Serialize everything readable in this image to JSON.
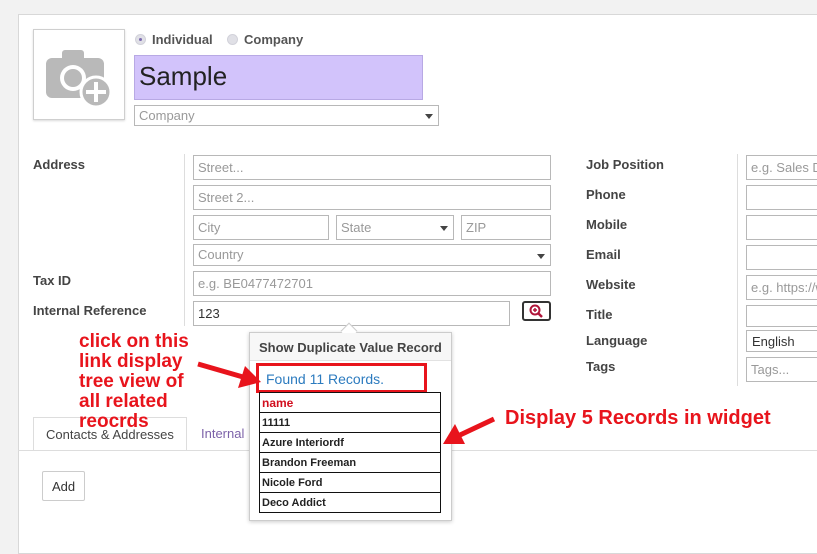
{
  "partner_type": {
    "individual": "Individual",
    "company": "Company",
    "selected": "individual"
  },
  "name": "Sample",
  "company_select": "Company",
  "labels": {
    "address": "Address",
    "tax_id": "Tax ID",
    "internal_reference": "Internal Reference",
    "job_position": "Job Position",
    "phone": "Phone",
    "mobile": "Mobile",
    "email": "Email",
    "website": "Website",
    "title": "Title",
    "language": "Language",
    "tags": "Tags"
  },
  "placeholders": {
    "street": "Street...",
    "street2": "Street 2...",
    "city": "City",
    "state": "State",
    "zip": "ZIP",
    "country": "Country",
    "tax_id": "e.g. BE0477472701",
    "job_position": "e.g. Sales D",
    "website": "e.g. https://w",
    "tags": "Tags..."
  },
  "values": {
    "internal_reference": "123",
    "language": "English"
  },
  "popup": {
    "header": "Show Duplicate Value Record",
    "found_link": "Found 11 Records.",
    "column": "name",
    "records": [
      "11111",
      "Azure Interiordf",
      "Brandon Freeman",
      "Nicole Ford",
      "Deco Addict"
    ]
  },
  "annotations": {
    "left": [
      "click on this",
      "link display",
      "tree view of",
      "all related",
      "reocrds"
    ],
    "right": "Display 5 Records in widget"
  },
  "tabs": [
    {
      "label": "Contacts & Addresses"
    },
    {
      "label": "Internal N"
    }
  ],
  "add_button": "Add",
  "colors": {
    "name_highlight": "#d2c3fb",
    "annotation": "#e8141c",
    "link": "#2c7bbf",
    "accent": "#7c62a9"
  }
}
